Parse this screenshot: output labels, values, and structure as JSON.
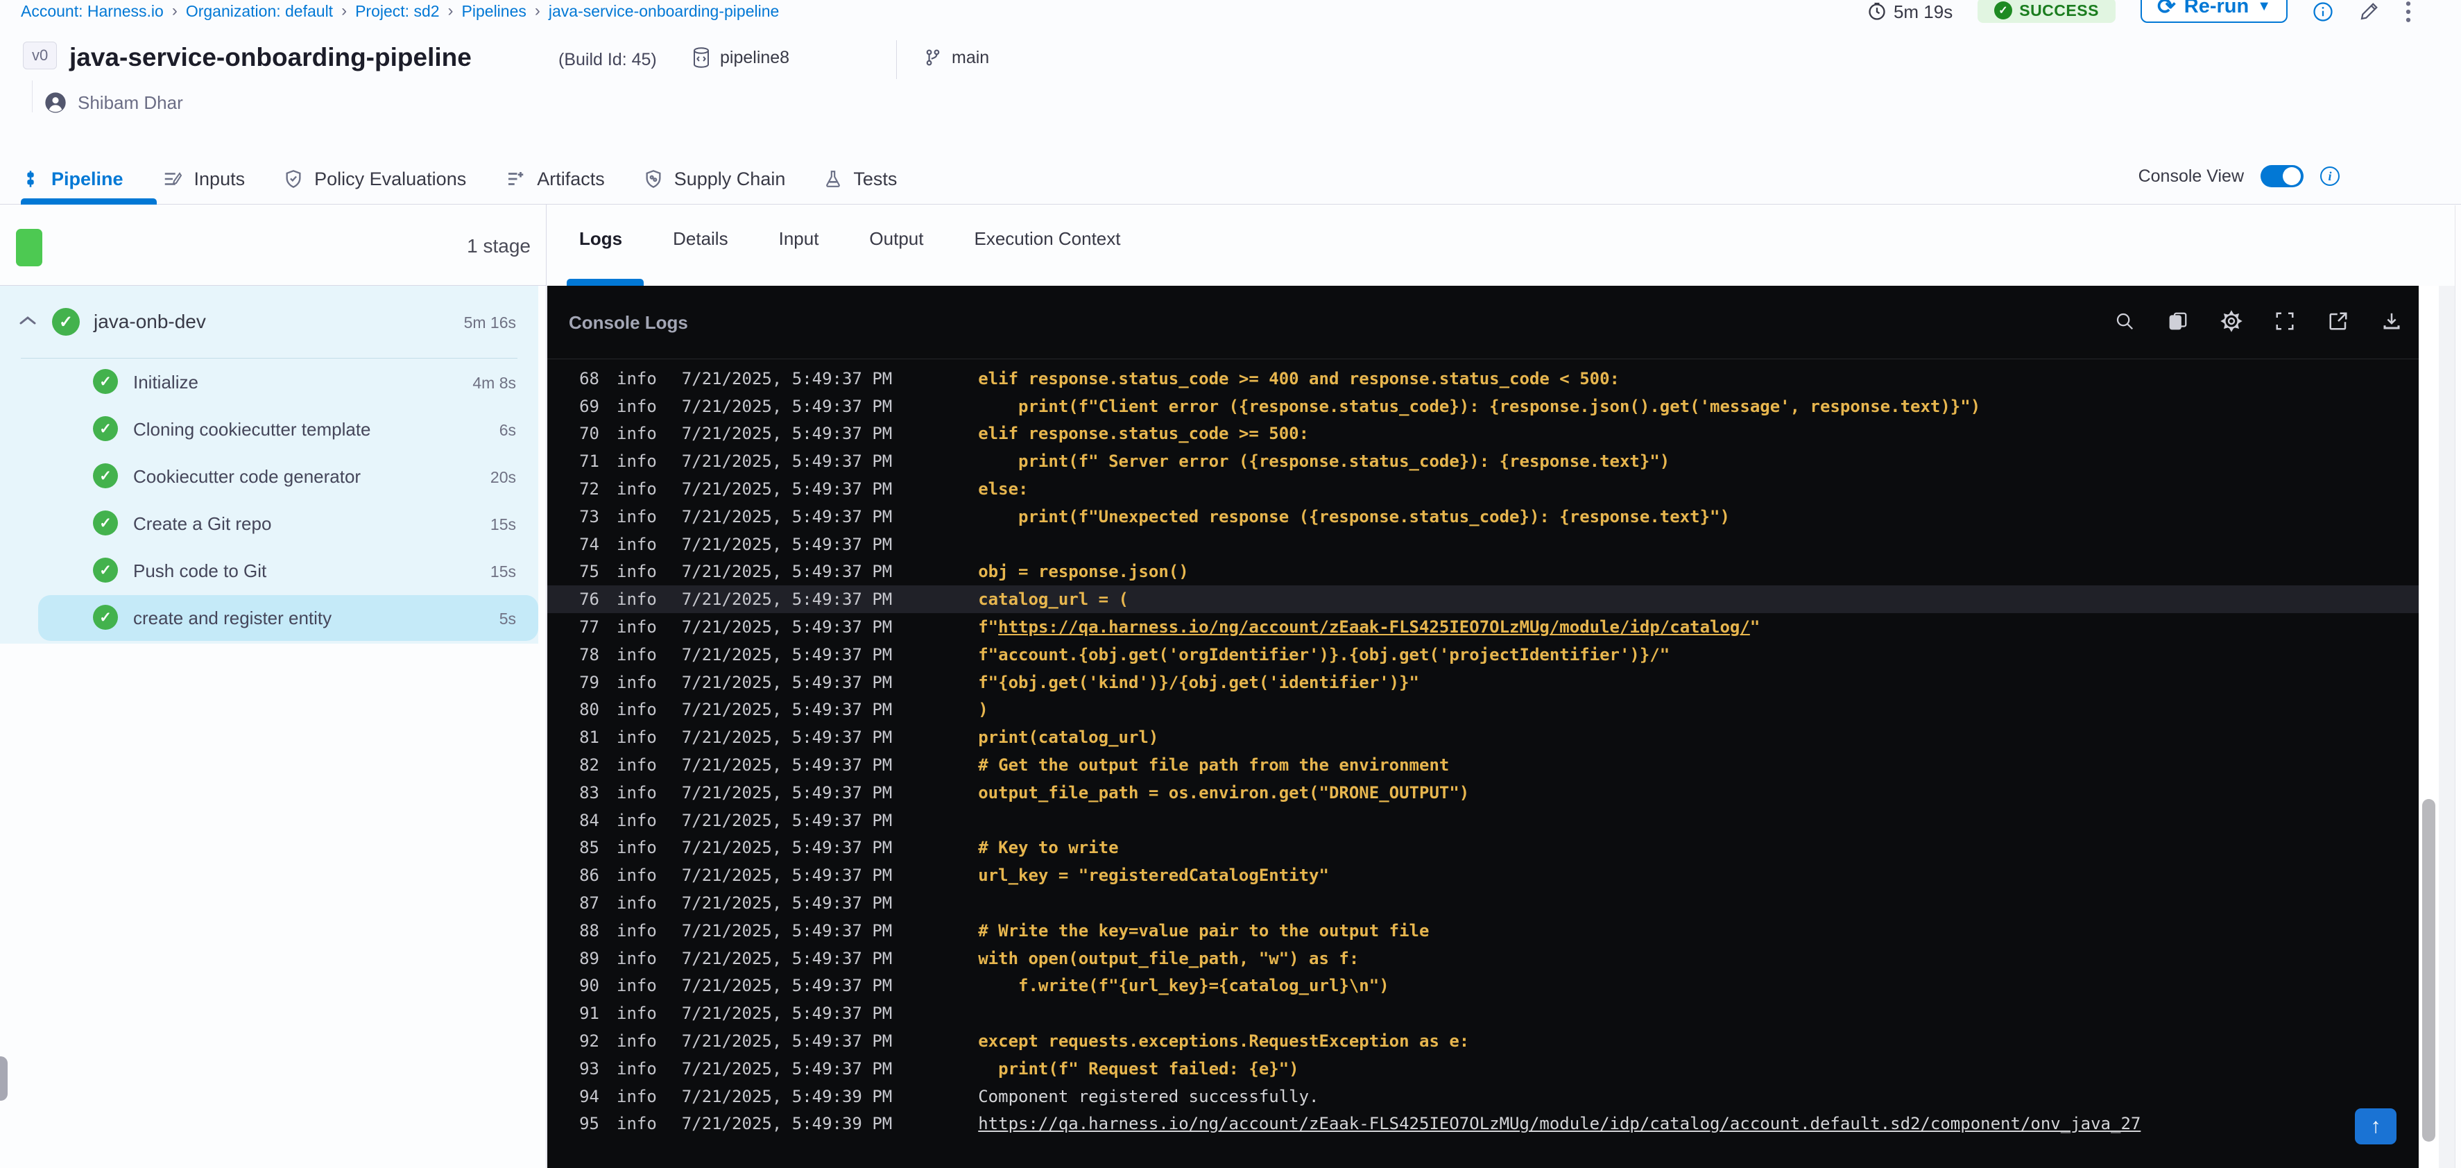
{
  "colors": {
    "accent_blue": "#0278d5",
    "success_green": "#4dc952",
    "code_yellow": "#e7b64e",
    "console_bg": "#0b0c0e",
    "stage_bg": "#e7f5fb"
  },
  "breadcrumbs": [
    "Account: Harness.io",
    "Organization: default",
    "Project: sd2",
    "Pipelines",
    "java-service-onboarding-pipeline"
  ],
  "topbar": {
    "duration": "5m 19s",
    "status": "SUCCESS",
    "rerun_label": "Re-run",
    "icons": [
      "clock-icon",
      "rerun-refresh-icon",
      "rerun-caret-icon",
      "info-icon",
      "edit-pencil-icon",
      "kebab-menu-icon"
    ]
  },
  "header": {
    "version_badge": "v0",
    "title": "java-service-onboarding-pipeline",
    "build_id": "(Build Id: 45)",
    "repo": "pipeline8",
    "branch": "main",
    "user": "Shibam Dhar"
  },
  "tabs": {
    "items": [
      {
        "label": "Pipeline"
      },
      {
        "label": "Inputs"
      },
      {
        "label": "Policy Evaluations"
      },
      {
        "label": "Artifacts"
      },
      {
        "label": "Supply Chain"
      },
      {
        "label": "Tests"
      }
    ],
    "active": "Pipeline",
    "console_view_label": "Console View",
    "console_view_on": true
  },
  "stage_panel": {
    "stage_count": "1 stage",
    "stage": {
      "name": "java-onb-dev",
      "duration": "5m 16s"
    },
    "steps": [
      {
        "label": "Initialize",
        "duration": "4m 8s",
        "selected": false
      },
      {
        "label": "Cloning cookiecutter template",
        "duration": "6s",
        "selected": false
      },
      {
        "label": "Cookiecutter code generator",
        "duration": "20s",
        "selected": false
      },
      {
        "label": "Create a Git repo",
        "duration": "15s",
        "selected": false
      },
      {
        "label": "Push code to Git",
        "duration": "15s",
        "selected": false
      },
      {
        "label": "create and register entity",
        "duration": "5s",
        "selected": true
      }
    ]
  },
  "log_panel": {
    "tabs": [
      {
        "label": "Logs"
      },
      {
        "label": "Details"
      },
      {
        "label": "Input"
      },
      {
        "label": "Output"
      },
      {
        "label": "Execution Context"
      }
    ],
    "active_tab": "Logs",
    "title": "Console Logs",
    "toolbar_icons": [
      "search-icon",
      "copy-icon",
      "gear-icon",
      "fullscreen-icon",
      "open-in-new-icon",
      "download-icon"
    ]
  },
  "logs": {
    "level_label": "info",
    "rows": [
      {
        "n": "68",
        "ts": "7/21/2025, 5:49:37 PM",
        "kind": "code",
        "pre": "elif response.status_code >= 400 and response.status_code < 500:"
      },
      {
        "n": "69",
        "ts": "7/21/2025, 5:49:37 PM",
        "kind": "code",
        "pre": "    print(f\"Client error ({response.status_code}): {response.json().get('message', response.text)}\")"
      },
      {
        "n": "70",
        "ts": "7/21/2025, 5:49:37 PM",
        "kind": "code",
        "pre": "elif response.status_code >= 500:"
      },
      {
        "n": "71",
        "ts": "7/21/2025, 5:49:37 PM",
        "kind": "code",
        "pre": "    print(f\" Server error ({response.status_code}): {response.text}\")"
      },
      {
        "n": "72",
        "ts": "7/21/2025, 5:49:37 PM",
        "kind": "code",
        "pre": "else:"
      },
      {
        "n": "73",
        "ts": "7/21/2025, 5:49:37 PM",
        "kind": "code",
        "pre": "    print(f\"Unexpected response ({response.status_code}): {response.text}\")"
      },
      {
        "n": "74",
        "ts": "7/21/2025, 5:49:37 PM",
        "kind": "code",
        "pre": ""
      },
      {
        "n": "75",
        "ts": "7/21/2025, 5:49:37 PM",
        "kind": "code",
        "pre": "obj = response.json()"
      },
      {
        "n": "76",
        "ts": "7/21/2025, 5:49:37 PM",
        "kind": "code",
        "pre": "catalog_url = (",
        "hl": true
      },
      {
        "n": "77",
        "ts": "7/21/2025, 5:49:37 PM",
        "kind": "code",
        "pre": "f\"",
        "link": "https://qa.harness.io/ng/account/zEaak-FLS425IEO7OLzMUg/module/idp/catalog/",
        "post": "\""
      },
      {
        "n": "78",
        "ts": "7/21/2025, 5:49:37 PM",
        "kind": "code",
        "pre": "f\"account.{obj.get('orgIdentifier')}.{obj.get('projectIdentifier')}/\""
      },
      {
        "n": "79",
        "ts": "7/21/2025, 5:49:37 PM",
        "kind": "code",
        "pre": "f\"{obj.get('kind')}/{obj.get('identifier')}\""
      },
      {
        "n": "80",
        "ts": "7/21/2025, 5:49:37 PM",
        "kind": "code",
        "pre": ")"
      },
      {
        "n": "81",
        "ts": "7/21/2025, 5:49:37 PM",
        "kind": "code",
        "pre": "print(catalog_url)"
      },
      {
        "n": "82",
        "ts": "7/21/2025, 5:49:37 PM",
        "kind": "code",
        "pre": "# Get the output file path from the environment"
      },
      {
        "n": "83",
        "ts": "7/21/2025, 5:49:37 PM",
        "kind": "code",
        "pre": "output_file_path = os.environ.get(\"DRONE_OUTPUT\")"
      },
      {
        "n": "84",
        "ts": "7/21/2025, 5:49:37 PM",
        "kind": "code",
        "pre": ""
      },
      {
        "n": "85",
        "ts": "7/21/2025, 5:49:37 PM",
        "kind": "code",
        "pre": "# Key to write"
      },
      {
        "n": "86",
        "ts": "7/21/2025, 5:49:37 PM",
        "kind": "code",
        "pre": "url_key = \"registeredCatalogEntity\""
      },
      {
        "n": "87",
        "ts": "7/21/2025, 5:49:37 PM",
        "kind": "code",
        "pre": ""
      },
      {
        "n": "88",
        "ts": "7/21/2025, 5:49:37 PM",
        "kind": "code",
        "pre": "# Write the key=value pair to the output file"
      },
      {
        "n": "89",
        "ts": "7/21/2025, 5:49:37 PM",
        "kind": "code",
        "pre": "with open(output_file_path, \"w\") as f:"
      },
      {
        "n": "90",
        "ts": "7/21/2025, 5:49:37 PM",
        "kind": "code",
        "pre": "    f.write(f\"{url_key}={catalog_url}\\n\")"
      },
      {
        "n": "91",
        "ts": "7/21/2025, 5:49:37 PM",
        "kind": "code",
        "pre": ""
      },
      {
        "n": "92",
        "ts": "7/21/2025, 5:49:37 PM",
        "kind": "code",
        "pre": "except requests.exceptions.RequestException as e:"
      },
      {
        "n": "93",
        "ts": "7/21/2025, 5:49:37 PM",
        "kind": "code",
        "pre": "  print(f\" Request failed: {e}\")"
      },
      {
        "n": "94",
        "ts": "7/21/2025, 5:49:39 PM",
        "kind": "out",
        "pre": "Component registered successfully."
      },
      {
        "n": "95",
        "ts": "7/21/2025, 5:49:39 PM",
        "kind": "out",
        "pre": "",
        "link": "https://qa.harness.io/ng/account/zEaak-FLS425IEO7OLzMUg/module/idp/catalog/account.default.sd2/component/onv_java_27",
        "post": ""
      }
    ]
  }
}
